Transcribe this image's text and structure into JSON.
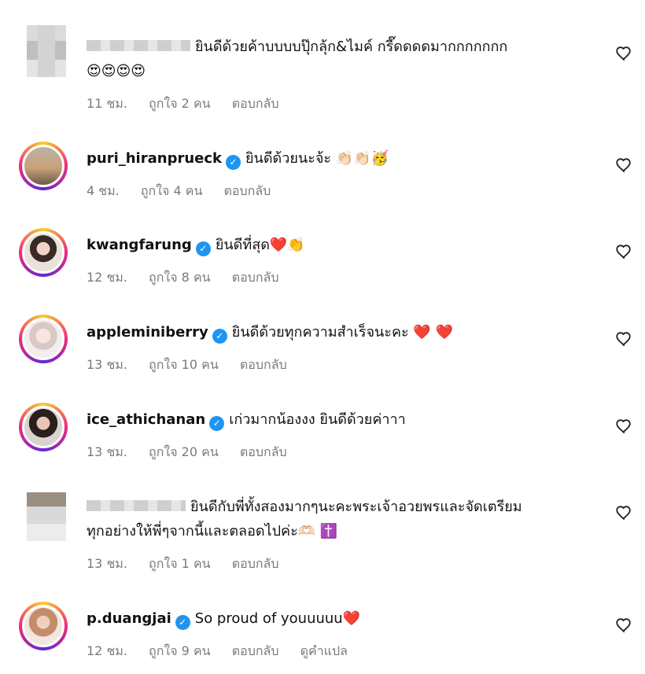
{
  "comments": [
    {
      "username": "",
      "text": "ยินดีด้วยค้าบบบบปุ๊กลุ้ก&ไมค์ กรี๊ดดดดมากกกกกกก",
      "line2": "😍😍😍😍",
      "time": "11 ชม.",
      "likes": "ถูกใจ 2 คน",
      "reply": "ตอบกลับ"
    },
    {
      "username": "puri_hiranprueck",
      "text": "ยินดีด้วยนะจ้ะ 👏🏻👏🏻🥳",
      "time": "4 ชม.",
      "likes": "ถูกใจ 4 คน",
      "reply": "ตอบกลับ"
    },
    {
      "username": "kwangfarung",
      "text": "ยินดีที่สุด❤️👏",
      "time": "12 ชม.",
      "likes": "ถูกใจ 8 คน",
      "reply": "ตอบกลับ"
    },
    {
      "username": "appleminiberry",
      "text": "ยินดีด้วยทุกความสำเร็จนะคะ ❤️ ❤️",
      "time": "13 ชม.",
      "likes": "ถูกใจ 10 คน",
      "reply": "ตอบกลับ"
    },
    {
      "username": "ice_athichanan",
      "text": "เก่วมากน้องงง ยินดีด้วยค่าาา",
      "time": "13 ชม.",
      "likes": "ถูกใจ 20 คน",
      "reply": "ตอบกลับ"
    },
    {
      "username": "",
      "text": "ยินดีกับพี่ทั้งสองมากๆนะคะพระเจ้าอวยพรและจัดเตรียม",
      "line2": "ทุกอย่างให้พี่ๆจากนี้และตลอดไปค่ะ🫶🏻 ✝️",
      "time": "13 ชม.",
      "likes": "ถูกใจ 1 คน",
      "reply": "ตอบกลับ"
    },
    {
      "username": "p.duangjai",
      "text": "So proud of youuuuu❤️",
      "time": "12 ชม.",
      "likes": "ถูกใจ 9 คน",
      "reply": "ตอบกลับ",
      "translate": "ดูคำแปล"
    }
  ],
  "icons": {
    "like": "heart-outline-icon",
    "verified": "verified-badge-icon"
  },
  "colors": {
    "verified": "#1e95f2",
    "meta": "#7a7a7a",
    "heart_emoji": "#e8234a"
  }
}
